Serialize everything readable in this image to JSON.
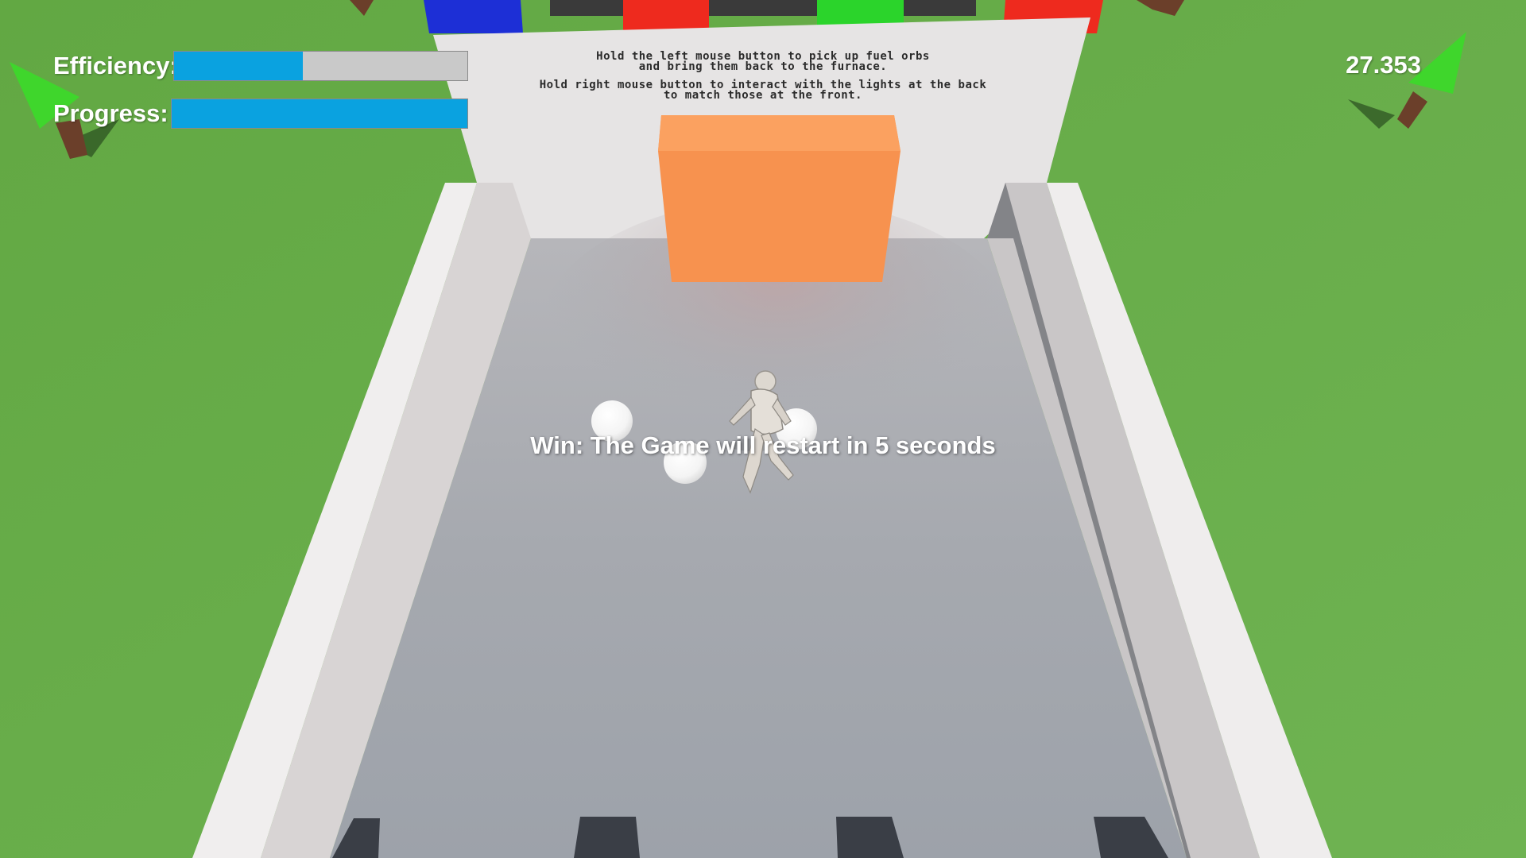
{
  "hud": {
    "efficiency_label": "Efficiency:",
    "efficiency_value": 0.44,
    "progress_label": "Progress:",
    "progress_value": 1.0,
    "timer": "27.353"
  },
  "instructions": {
    "line1": "Hold the left mouse button to pick up fuel orbs",
    "line2": "and bring them back to the furnace.",
    "line3": "Hold right mouse button to interact with the lights at the back",
    "line4": "to match those at the front."
  },
  "status_message": "Win: The Game will restart in 5 seconds",
  "colors": {
    "grass": "#6aac4d",
    "floor": "#a4a8ae",
    "wall": "#e6e4e4",
    "furnace": "#f7924f",
    "light_blue": "#1d2fd6",
    "light_red": "#ee2a1e",
    "light_green": "#2bd42b",
    "bar_fill": "#0aa2e0",
    "bar_empty": "#c9c9c9",
    "tree_cone": "#3fd62c"
  },
  "scene_objects": {
    "back_lights": [
      "blue",
      "red",
      "green",
      "red"
    ],
    "fuel_orbs": 3,
    "character": "mannequin"
  }
}
